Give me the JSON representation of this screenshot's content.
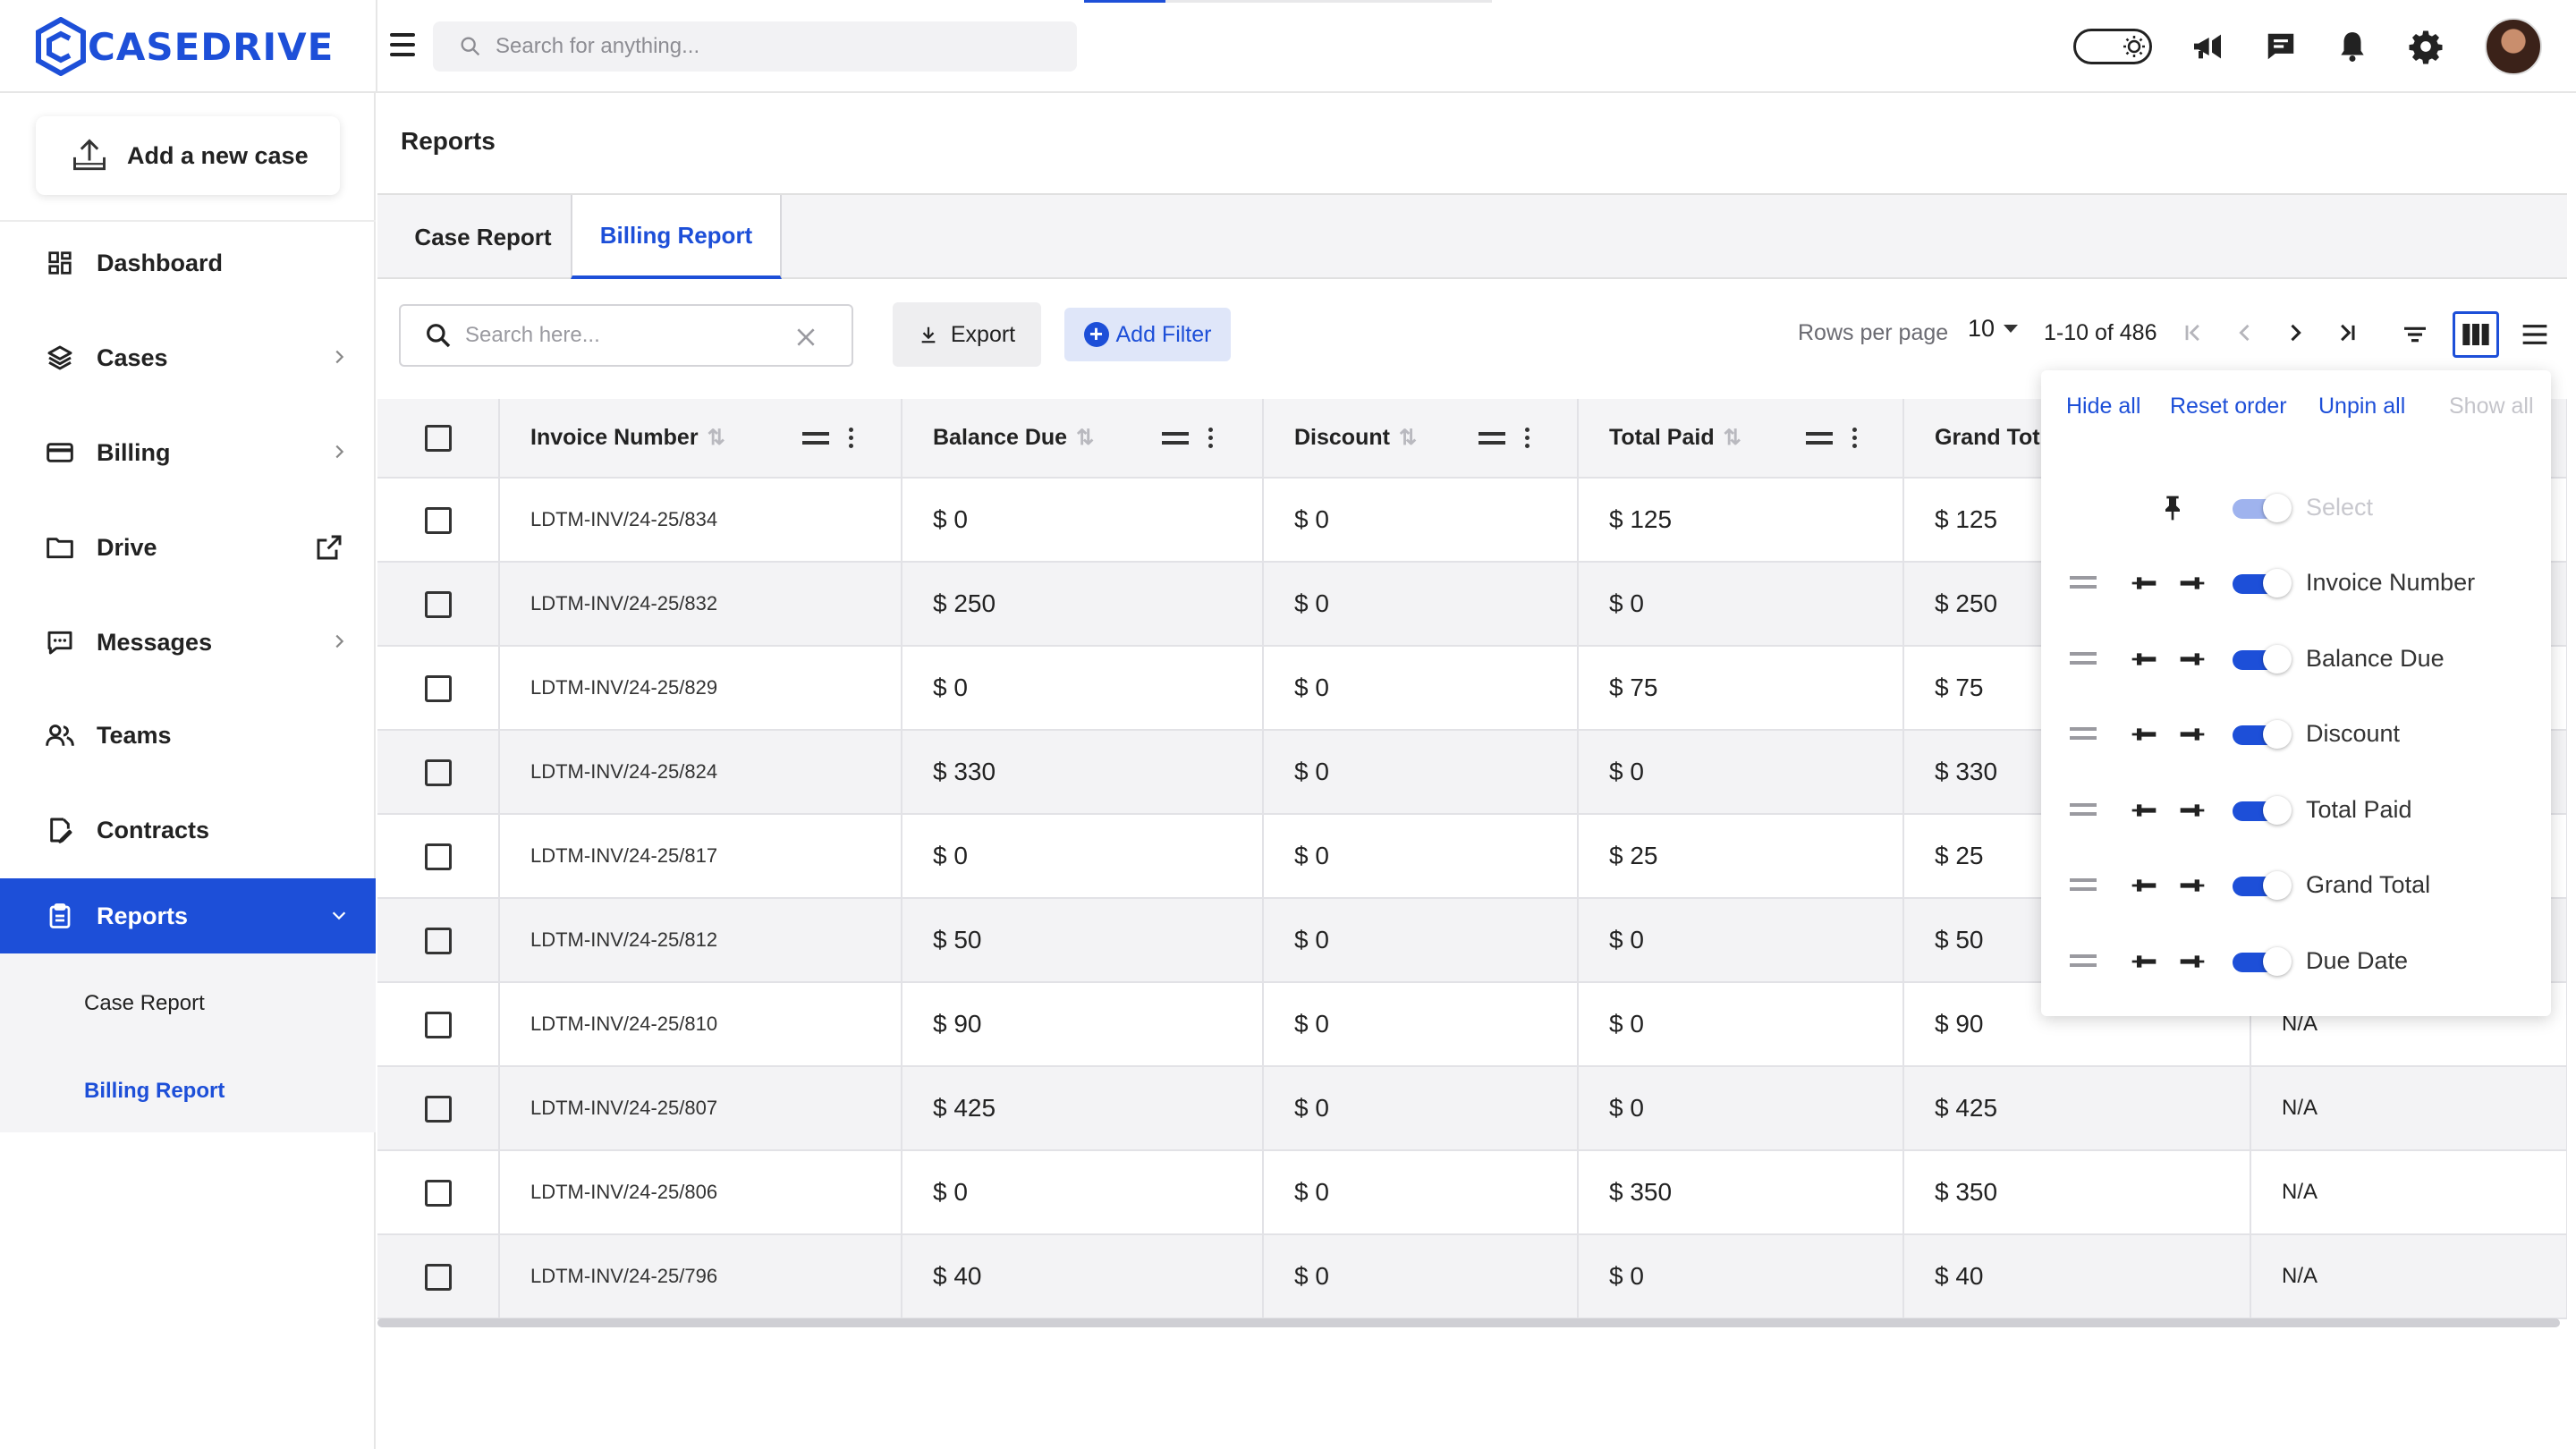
{
  "app": {
    "name": "CASEDRIVE",
    "brand_color": "#1d4fd8"
  },
  "header": {
    "search_placeholder": "Search for anything...",
    "icons": [
      "theme-toggle-icon",
      "megaphone-icon",
      "chat-icon",
      "bell-icon",
      "gear-icon",
      "avatar"
    ]
  },
  "sidebar": {
    "add_case_label": "Add a new case",
    "items": [
      {
        "label": "Dashboard",
        "icon": "dashboard-icon"
      },
      {
        "label": "Cases",
        "icon": "layers-icon"
      },
      {
        "label": "Billing",
        "icon": "card-icon"
      },
      {
        "label": "Drive",
        "icon": "folder-icon"
      },
      {
        "label": "Messages",
        "icon": "message-icon"
      },
      {
        "label": "Teams",
        "icon": "team-icon"
      },
      {
        "label": "Contracts",
        "icon": "contract-icon"
      },
      {
        "label": "Reports",
        "icon": "clipboard-icon"
      }
    ],
    "reports_sub": [
      "Case Report",
      "Billing Report"
    ]
  },
  "page": {
    "title": "Reports",
    "tabs": [
      "Case Report",
      "Billing Report"
    ],
    "active_tab": "Billing Report"
  },
  "toolbar": {
    "search_placeholder": "Search here...",
    "export_label": "Export",
    "add_filter_label": "Add Filter",
    "rows_per_page_label": "Rows per page",
    "rows_per_page_value": "10",
    "page_range": "1-10 of 486"
  },
  "table": {
    "headers": [
      "Invoice Number",
      "Balance Due",
      "Discount",
      "Total Paid",
      "Grand Tot"
    ],
    "rows": [
      {
        "invoice": "LDTM-INV/24-25/834",
        "balance": "$ 0",
        "discount": "$ 0",
        "paid": "$ 125",
        "grand": "$ 125",
        "due": ""
      },
      {
        "invoice": "LDTM-INV/24-25/832",
        "balance": "$ 250",
        "discount": "$ 0",
        "paid": "$ 0",
        "grand": "$ 250",
        "due": ""
      },
      {
        "invoice": "LDTM-INV/24-25/829",
        "balance": "$ 0",
        "discount": "$ 0",
        "paid": "$ 75",
        "grand": "$ 75",
        "due": ""
      },
      {
        "invoice": "LDTM-INV/24-25/824",
        "balance": "$ 330",
        "discount": "$ 0",
        "paid": "$ 0",
        "grand": "$ 330",
        "due": ""
      },
      {
        "invoice": "LDTM-INV/24-25/817",
        "balance": "$ 0",
        "discount": "$ 0",
        "paid": "$ 25",
        "grand": "$ 25",
        "due": ""
      },
      {
        "invoice": "LDTM-INV/24-25/812",
        "balance": "$ 50",
        "discount": "$ 0",
        "paid": "$ 0",
        "grand": "$ 50",
        "due": ""
      },
      {
        "invoice": "LDTM-INV/24-25/810",
        "balance": "$ 90",
        "discount": "$ 0",
        "paid": "$ 0",
        "grand": "$ 90",
        "due": "N/A"
      },
      {
        "invoice": "LDTM-INV/24-25/807",
        "balance": "$ 425",
        "discount": "$ 0",
        "paid": "$ 0",
        "grand": "$ 425",
        "due": "N/A"
      },
      {
        "invoice": "LDTM-INV/24-25/806",
        "balance": "$ 0",
        "discount": "$ 0",
        "paid": "$ 350",
        "grand": "$ 350",
        "due": "N/A"
      },
      {
        "invoice": "LDTM-INV/24-25/796",
        "balance": "$ 40",
        "discount": "$ 0",
        "paid": "$ 0",
        "grand": "$ 40",
        "due": "N/A"
      }
    ]
  },
  "column_panel": {
    "hide_all": "Hide all",
    "reset_order": "Reset order",
    "unpin_all": "Unpin all",
    "show_all": "Show all",
    "select_label": "Select",
    "columns": [
      "Invoice Number",
      "Balance Due",
      "Discount",
      "Total Paid",
      "Grand Total",
      "Due Date"
    ]
  }
}
